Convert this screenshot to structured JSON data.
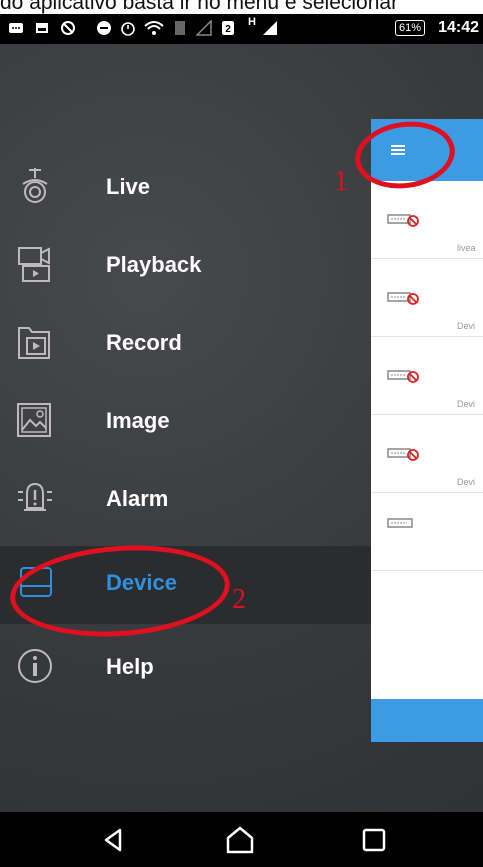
{
  "caption": "do aplicativo basta ir no menu e selecionar",
  "status_bar": {
    "battery": "61%",
    "time": "14:42",
    "network": "H"
  },
  "menu": {
    "items": [
      {
        "label": "Live",
        "icon": "camera-icon",
        "active": false
      },
      {
        "label": "Playback",
        "icon": "playback-icon",
        "active": false
      },
      {
        "label": "Record",
        "icon": "record-folder-icon",
        "active": false
      },
      {
        "label": "Image",
        "icon": "image-icon",
        "active": false
      },
      {
        "label": "Alarm",
        "icon": "alarm-icon",
        "active": false
      },
      {
        "label": "Device",
        "icon": "device-icon",
        "active": true
      },
      {
        "label": "Help",
        "icon": "info-icon",
        "active": false
      }
    ]
  },
  "panel": {
    "rows": [
      {
        "label": "livea",
        "icon": "dvr-offline-icon"
      },
      {
        "label": "Devi",
        "icon": "dvr-offline-icon"
      },
      {
        "label": "Devi",
        "icon": "dvr-offline-icon"
      },
      {
        "label": "Devi",
        "icon": "dvr-offline-icon"
      },
      {
        "label": "",
        "icon": "dvr-icon"
      }
    ]
  },
  "annotations": {
    "step1": "1",
    "step2": "2"
  },
  "colors": {
    "accent": "#3d9be4",
    "active_text": "#2f8fe0",
    "annotation": "#e01020",
    "drawer_bg": "#3a3c3f"
  }
}
